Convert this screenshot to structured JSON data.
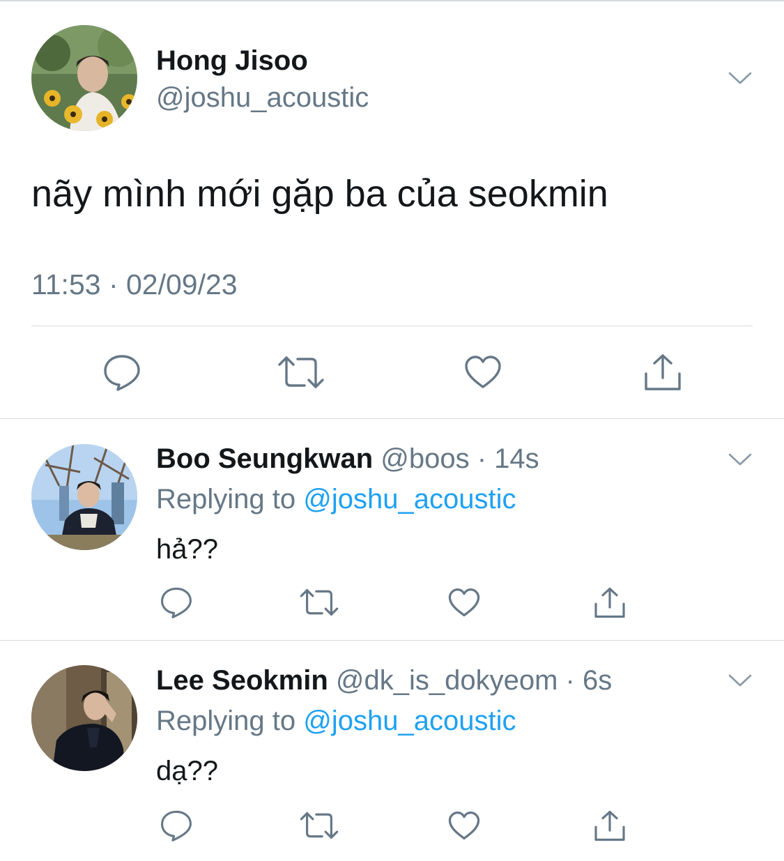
{
  "main_tweet": {
    "author_name": "Hong Jisoo",
    "author_handle": "@joshu_acoustic",
    "text": "nãy mình mới gặp ba của seokmin",
    "timestamp": "11:53 · 02/09/23",
    "icons": {
      "menu": "chevron-down-icon",
      "reply": "comment-icon",
      "retweet": "retweet-icon",
      "like": "heart-icon",
      "share": "share-icon"
    }
  },
  "replies": [
    {
      "author_name": "Boo Seungkwan",
      "author_handle": "@boos",
      "separator": " · ",
      "time_ago": "14s",
      "replying_prefix": "Replying to ",
      "replying_to": "@joshu_acoustic",
      "text": "hả??"
    },
    {
      "author_name": "Lee Seokmin",
      "author_handle": "@dk_is_dokyeom",
      "separator": " · ",
      "time_ago": "6s",
      "replying_prefix": "Replying to ",
      "replying_to": "@joshu_acoustic",
      "text": "dạ??"
    }
  ],
  "colors": {
    "text_primary": "#14171a",
    "text_secondary": "#657786",
    "link": "#1da1f2",
    "divider": "#d6dade",
    "icon": "#657786"
  }
}
